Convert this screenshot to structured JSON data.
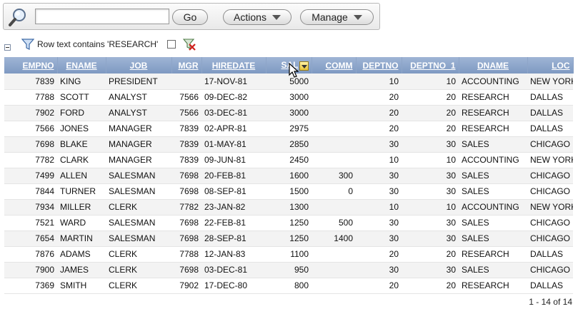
{
  "toolbar": {
    "search_icon": "magnifier-icon",
    "search_value": "",
    "go_label": "Go",
    "actions_label": "Actions",
    "manage_label": "Manage"
  },
  "filter": {
    "icon": "funnel-icon",
    "text": "Row text contains 'RESEARCH'",
    "remove_icon": "remove-filter-icon"
  },
  "report": {
    "columns": [
      "EMPNO",
      "ENAME",
      "JOB",
      "MGR",
      "HIREDATE",
      "SAL",
      "COMM",
      "DEPTNO",
      "DEPTNO_1",
      "DNAME",
      "LOC"
    ],
    "sorted_column": "SAL",
    "rows": [
      [
        "7839",
        "KING",
        "PRESIDENT",
        "",
        "17-NOV-81",
        "5000",
        "",
        "10",
        "10",
        "ACCOUNTING",
        "NEW YORK"
      ],
      [
        "7788",
        "SCOTT",
        "ANALYST",
        "7566",
        "09-DEC-82",
        "3000",
        "",
        "20",
        "20",
        "RESEARCH",
        "DALLAS"
      ],
      [
        "7902",
        "FORD",
        "ANALYST",
        "7566",
        "03-DEC-81",
        "3000",
        "",
        "20",
        "20",
        "RESEARCH",
        "DALLAS"
      ],
      [
        "7566",
        "JONES",
        "MANAGER",
        "7839",
        "02-APR-81",
        "2975",
        "",
        "20",
        "20",
        "RESEARCH",
        "DALLAS"
      ],
      [
        "7698",
        "BLAKE",
        "MANAGER",
        "7839",
        "01-MAY-81",
        "2850",
        "",
        "30",
        "30",
        "SALES",
        "CHICAGO"
      ],
      [
        "7782",
        "CLARK",
        "MANAGER",
        "7839",
        "09-JUN-81",
        "2450",
        "",
        "10",
        "10",
        "ACCOUNTING",
        "NEW YORK"
      ],
      [
        "7499",
        "ALLEN",
        "SALESMAN",
        "7698",
        "20-FEB-81",
        "1600",
        "300",
        "30",
        "30",
        "SALES",
        "CHICAGO"
      ],
      [
        "7844",
        "TURNER",
        "SALESMAN",
        "7698",
        "08-SEP-81",
        "1500",
        "0",
        "30",
        "30",
        "SALES",
        "CHICAGO"
      ],
      [
        "7934",
        "MILLER",
        "CLERK",
        "7782",
        "23-JAN-82",
        "1300",
        "",
        "10",
        "10",
        "ACCOUNTING",
        "NEW YORK"
      ],
      [
        "7521",
        "WARD",
        "SALESMAN",
        "7698",
        "22-FEB-81",
        "1250",
        "500",
        "30",
        "30",
        "SALES",
        "CHICAGO"
      ],
      [
        "7654",
        "MARTIN",
        "SALESMAN",
        "7698",
        "28-SEP-81",
        "1250",
        "1400",
        "30",
        "30",
        "SALES",
        "CHICAGO"
      ],
      [
        "7876",
        "ADAMS",
        "CLERK",
        "7788",
        "12-JAN-83",
        "1100",
        "",
        "20",
        "20",
        "RESEARCH",
        "DALLAS"
      ],
      [
        "7900",
        "JAMES",
        "CLERK",
        "7698",
        "03-DEC-81",
        "950",
        "",
        "30",
        "30",
        "SALES",
        "CHICAGO"
      ],
      [
        "7369",
        "SMITH",
        "CLERK",
        "7902",
        "17-DEC-80",
        "800",
        "",
        "20",
        "20",
        "RESEARCH",
        "DALLAS"
      ]
    ]
  },
  "pagination": "1 - 14 of 14",
  "colors": {
    "header_bg": "#8aa3c9",
    "header_text": "#ffffff",
    "row_alt": "#f3f3f3"
  }
}
